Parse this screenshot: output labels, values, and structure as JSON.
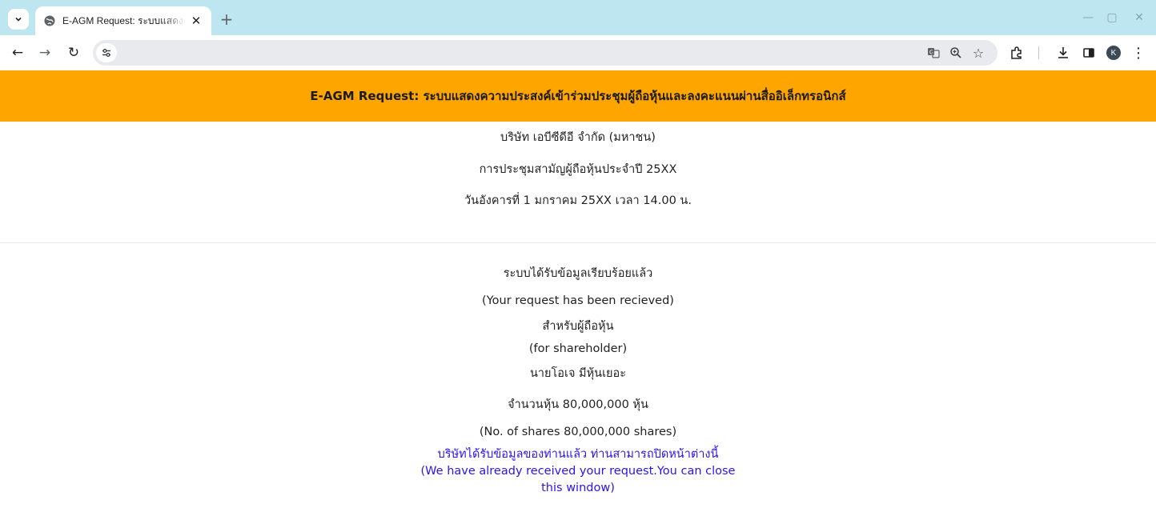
{
  "browser": {
    "tab": {
      "title": "E-AGM Request: ระบบแสดงความประสงค์เข้าร่วมประชุม",
      "close_glyph": "✕"
    },
    "new_tab_glyph": "+",
    "window_controls": {
      "minimize": "—",
      "maximize": "▢",
      "close": "✕"
    },
    "nav": {
      "back": "←",
      "forward": "→",
      "reload": "↻"
    },
    "omnibox_icons": [
      "translate-icon",
      "zoom-icon",
      "bookmark-star-icon"
    ],
    "toolbar_icons": [
      "extensions-icon",
      "download-icon",
      "side-panel-icon",
      "profile-avatar",
      "menu-icon"
    ],
    "profile_initial": "K"
  },
  "page": {
    "banner_title": "E-AGM Request: ระบบแสดงความประสงค์เข้าร่วมประชุมผู้ถือหุ้นและลงคะแนนผ่านสื่ออิเล็กทรอนิกส์",
    "company_name": "บริษัท เอบีซีดีอี จำกัด (มหาชน)",
    "meeting_name": "การประชุมสามัญผู้ถือหุ้นประจำปี 25XX",
    "meeting_datetime": "วันอังคารที่ 1 มกราคม 25XX เวลา 14.00 น.",
    "received_th": "ระบบได้รับข้อมูลเรียบร้อยแล้ว",
    "received_en": "(Your request has been recieved)",
    "for_shareholder_th": "สำหรับผู้ถือหุ้น",
    "for_shareholder_en": "(for shareholder)",
    "shareholder_name": "นายโอเจ มีหุ้นเยอะ",
    "shares_th": "จำนวนหุ้น 80,000,000 หุ้น",
    "shares_en": "(No. of shares 80,000,000 shares)",
    "close_notice_th": "บริษัทได้รับข้อมูลของท่านแล้ว ท่านสามารถปิดหน้าต่างนี้",
    "close_notice_en": "(We have already received your request.You can close this window)"
  },
  "colors": {
    "banner": "#ffa500",
    "tabbar": "#bde6f0",
    "notice_text": "#2a14f0"
  }
}
